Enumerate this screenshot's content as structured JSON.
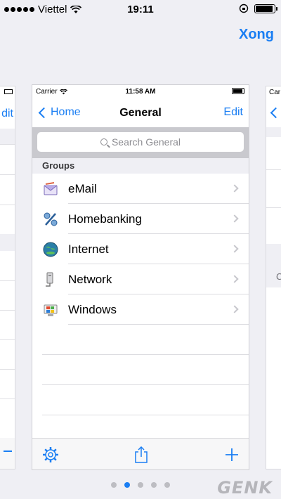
{
  "status_bar": {
    "carrier": "Viettel",
    "time": "19:11"
  },
  "outer_nav": {
    "done_label": "Xong"
  },
  "card": {
    "status": {
      "carrier": "Carrier",
      "time": "11:58 AM"
    },
    "nav": {
      "back_label": "Home",
      "title": "General",
      "edit_label": "Edit"
    },
    "search": {
      "placeholder": "Search General"
    },
    "section": {
      "title": "Groups"
    },
    "rows": [
      {
        "label": "eMail",
        "icon": "email-icon"
      },
      {
        "label": "Homebanking",
        "icon": "percent-icon"
      },
      {
        "label": "Internet",
        "icon": "globe-icon"
      },
      {
        "label": "Network",
        "icon": "network-icon"
      },
      {
        "label": "Windows",
        "icon": "windows-icon"
      }
    ],
    "empty_rows": 4,
    "toolbar": [
      "gear-icon",
      "share-icon",
      "plus-icon"
    ]
  },
  "left_card": {
    "edit_label": "dit"
  },
  "right_card": {
    "carrier": "Car"
  },
  "pagination": {
    "pages": 5,
    "active": 1
  },
  "watermark": "GENK",
  "colors": {
    "accent": "#1a7ef3",
    "background": "#efeff4"
  }
}
